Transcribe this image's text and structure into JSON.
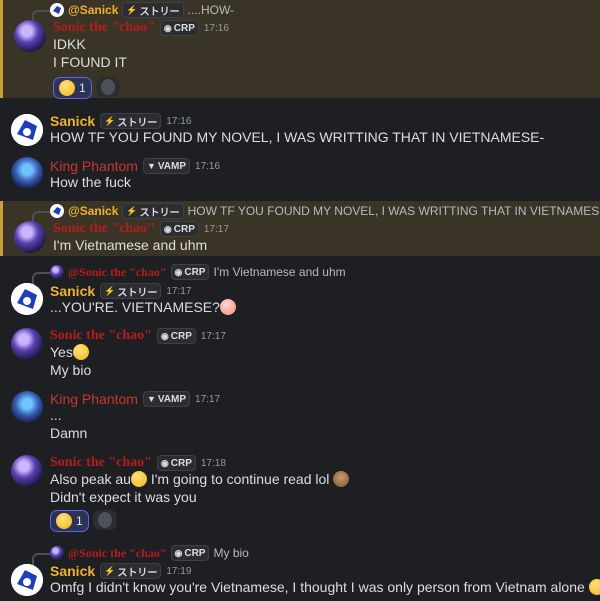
{
  "messages": [
    {
      "reply": {
        "name": "@Sanick",
        "tag": "ストリー",
        "text": "....HOW-"
      },
      "author": "Sonic the \"chao\"",
      "tag": "CRP",
      "time": "17:16",
      "lines": [
        "IDKK",
        "I FOUND IT"
      ],
      "reaction": {
        "count": "1"
      }
    },
    {
      "author": "Sanick",
      "tag": "ストリー",
      "time": "17:16",
      "lines": [
        "HOW TF YOU FOUND MY NOVEL, I WAS WRITTING THAT IN VIETNAMESE-"
      ]
    },
    {
      "author": "King Phantom",
      "tag": "VAMP",
      "time": "17:16",
      "lines": [
        "How the fuck"
      ]
    },
    {
      "reply": {
        "name": "@Sanick",
        "tag": "ストリー",
        "text": "HOW TF YOU FOUND MY NOVEL, I WAS WRITTING THAT IN VIETNAMESE-"
      },
      "author": "Sonic the \"chao\"",
      "tag": "CRP",
      "time": "17:17",
      "lines": [
        "I'm Vietnamese and uhm"
      ]
    },
    {
      "reply": {
        "name": "@Sonic the \"chao\"",
        "tag": "CRP",
        "text": "I'm Vietnamese and uhm"
      },
      "author": "Sanick",
      "tag": "ストリー",
      "time": "17:17",
      "lines": [
        "...YOU'RE. VIETNAMESE?"
      ]
    },
    {
      "author": "Sonic the \"chao\"",
      "tag": "CRP",
      "time": "17:17",
      "lines": [
        "Yes",
        "My bio"
      ]
    },
    {
      "author": "King Phantom",
      "tag": "VAMP",
      "time": "17:17",
      "lines": [
        "...",
        "Damn"
      ]
    },
    {
      "author": "Sonic the \"chao\"",
      "tag": "CRP",
      "time": "17:18",
      "lines": [
        "Also peak au",
        "I'm going to continue read lol",
        "Didn't expect it was you"
      ],
      "reaction": {
        "count": "1"
      }
    },
    {
      "reply": {
        "name": "@Sonic the \"chao\"",
        "tag": "CRP",
        "text": "My bio"
      },
      "author": "Sanick",
      "tag": "ストリー",
      "time": "17:19",
      "lines": [
        "Omfg I didn't know you're Vietnamese, I thought I was only person from Vietnam alone"
      ]
    }
  ],
  "icons": {
    "sanick_tag": "lightning-icon",
    "sonic_tag": "mask-icon",
    "king_tag": "fangs-icon",
    "reaction": "crying-laughing-emoji",
    "add_reaction": "add-reaction-icon"
  }
}
